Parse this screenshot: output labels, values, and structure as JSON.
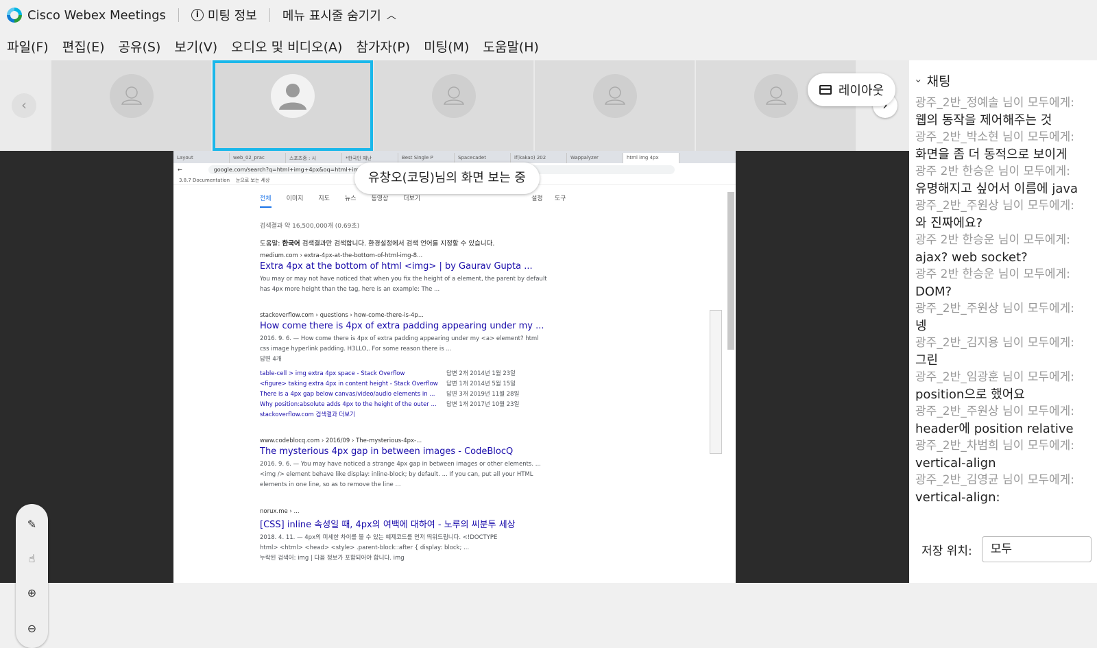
{
  "app": {
    "title": "Cisco Webex Meetings",
    "meeting_info": "미팅 정보",
    "hide_menu": "메뉴 표시줄 숨기기"
  },
  "menu": [
    "파일(F)",
    "편집(E)",
    "공유(S)",
    "보기(V)",
    "오디오 및 비디오(A)",
    "참가자(P)",
    "미팅(M)",
    "도움말(H)"
  ],
  "layout_button": "레이아웃",
  "viewing_label": "유창오(코딩)님의 화면 보는 중",
  "browser": {
    "tabs": [
      "Layout",
      "web_02_prac",
      "스포츠중 : 시",
      "*한국인 재난",
      "Best Single P",
      "Spacecadet",
      "if(kakao) 202",
      "Wappalyzer",
      "html img 4px"
    ],
    "url": "google.com/search?q=html+img+4px&oq=html+img",
    "bookmarks": [
      "3.8.7 Documentation",
      "눈으로 보는 세상"
    ]
  },
  "google": {
    "tabs": [
      "전체",
      "이미지",
      "지도",
      "뉴스",
      "동영상",
      "더보기"
    ],
    "settings": "설정",
    "tools": "도구",
    "count": "검색결과 약 16,500,000개 (0.69초)",
    "help_prefix": "도움말: ",
    "help_link": "한국어",
    "help_rest": " 검색결과만 검색합니다. 환경설정에서 검색 언어를 지정할 수 있습니다.",
    "results": [
      {
        "cite": "medium.com › extra-4px-at-the-bottom-of-html-img-8...",
        "title": "Extra 4px at the bottom of html <img> | by Gaurav Gupta ...",
        "snippet1": "You may or may not have noticed that when you fix the height of a element, the parent by default",
        "snippet2": "has 4px more height than the tag, here is an example: The ..."
      },
      {
        "cite": "stackoverflow.com › questions › how-come-there-is-4p...",
        "title": "How come there is 4px of extra padding appearing under my ...",
        "snippet1": "2016. 9. 6. — How come there is 4px of extra padding appearing under my <a> element? html",
        "snippet2": "css image hyperlink padding. H3LLO,. For some reason there is ...",
        "answers": "답변 4개"
      },
      {
        "cite": "www.codeblocq.com › 2016/09 › The-mysterious-4px-...",
        "title": "The mysterious 4px gap in between images - CodeBlocQ",
        "snippet1": "2016. 9. 6. — You may have noticed a strange 4px gap in between images or other elements. ...",
        "snippet2": "<img /> element behave like display: inline-block; by default. ... If you can, put all your HTML",
        "snippet3": "elements in one line, so as to remove the line ..."
      },
      {
        "cite": "norux.me › ...",
        "title": "[CSS] inline 속성일 때, 4px의 여백에 대하여 - 노루의 씨분투 세상",
        "snippet1": "2018. 4. 11. — 4px의 미세한 차이를 볼 수 있는 예제코드를 먼저 띄워드립니다. <!DOCTYPE",
        "snippet2": "html> <html> <head> <style> .parent-block::after { display: block; ...",
        "snippet3": "누락된 검색어: img | 다음 정보가 포함되어야 합니다. img"
      }
    ],
    "sublinks": [
      {
        "text": "table-cell > img extra 4px space - Stack Overflow",
        "date": "답변 2개    2014년 1월 23일"
      },
      {
        "text": "<figure> taking extra 4px in content height - Stack Overflow",
        "date": "답변 1개    2014년 5월 15일"
      },
      {
        "text": "There is a 4px gap below canvas/video/audio elements in ...",
        "date": "답변 3개    2019년 11월 28일"
      },
      {
        "text": "Why position:absolute adds 4px to the height of the outer ...",
        "date": "답변 1개    2017년 10월 23일"
      }
    ],
    "more": "stackoverflow.com 검색결과 더보기"
  },
  "chat": {
    "title": "채팅",
    "messages": [
      {
        "who": "광주_2반_정예솔 님이 모두에게:",
        "text": "웹의 동작을 제어해주는 것"
      },
      {
        "who": "광주_2반_박소현 님이 모두에게:",
        "text": "화면을 좀 더 동적으로 보이게"
      },
      {
        "who": "광주 2반 한승운 님이 모두에게:",
        "text": "유명해지고 싶어서 이름에 java"
      },
      {
        "who": "광주_2반_주원상 님이 모두에게:",
        "text": "와 진짜에요?"
      },
      {
        "who": "광주 2반 한승운 님이 모두에게:",
        "text": "ajax? web socket?"
      },
      {
        "who": "광주 2반 한승운 님이 모두에게:",
        "text": "DOM?"
      },
      {
        "who": "광주_2반_주원상 님이 모두에게:",
        "text": "넹"
      },
      {
        "who": "광주_2반_김지용 님이 모두에게:",
        "text": "그린"
      },
      {
        "who": "광주_2반_임광훈 님이 모두에게:",
        "text": "position으로 했어요"
      },
      {
        "who": "광주_2반_주원상 님이 모두에게:",
        "text": "header에 position relative"
      },
      {
        "who": "광주_2반_차범희 님이 모두에게:",
        "text": "vertical-align"
      },
      {
        "who": "광주_2반_김영균 님이 모두에게:",
        "text": "vertical-align:"
      }
    ],
    "save_label": "저장 위치:",
    "save_value": "모두"
  }
}
